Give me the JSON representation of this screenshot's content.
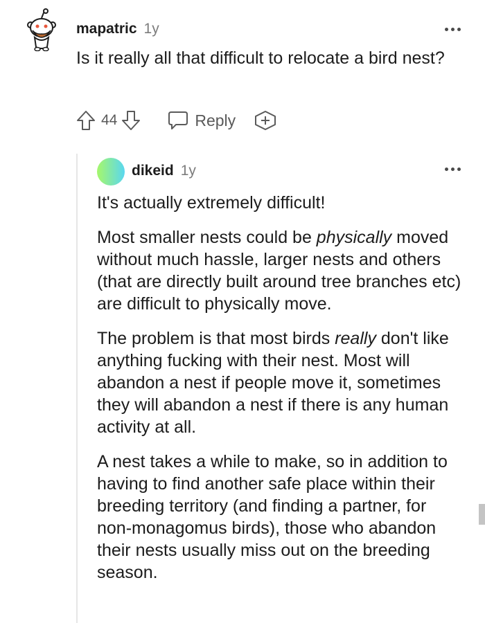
{
  "comment": {
    "username": "mapatric",
    "age": "1y",
    "text": "Is it really all that difficult to relocate a bird nest?",
    "votes": "44",
    "reply_label": "Reply",
    "avatar_icon": "snoo-avatar-icon"
  },
  "reply": {
    "username": "dikeid",
    "age": "1y",
    "avatar_colors": [
      "#a6f76b",
      "#59d7f0"
    ],
    "paragraphs": [
      {
        "text": "It's actually extremely difficult!"
      },
      {
        "before": "Most smaller nests could be ",
        "emph": "physically",
        "after": " moved without much hassle, larger nests and others (that are directly built around tree branches etc) are difficult to physically move."
      },
      {
        "before": "The problem is that most birds ",
        "emph": "really",
        "after": " don't like anything fucking with their nest. Most will abandon a nest if people move it, sometimes they will abandon a nest if there is any human activity at all."
      },
      {
        "text": "A nest takes a while to make, so in addition to having to find another safe place within their breeding territory (and finding a partner, for non-monagomus birds), those who abandon their nests usually miss out on the breeding season."
      }
    ]
  },
  "colors": {
    "text": "#1c1c1c",
    "muted": "#7c7c7c",
    "icon": "#5a5a5a",
    "thread_line": "#e6e6e6"
  }
}
